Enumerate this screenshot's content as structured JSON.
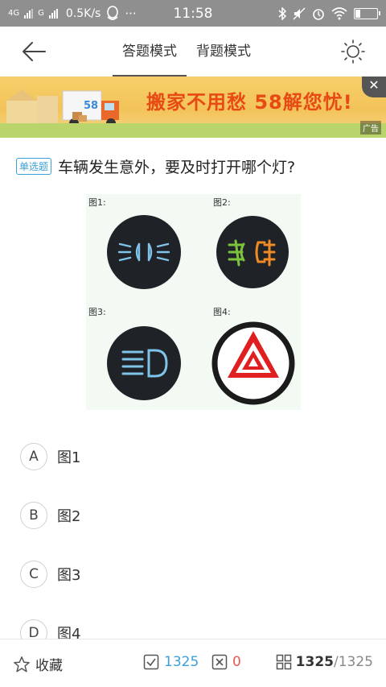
{
  "status_bar": {
    "network1": "4G",
    "network2": "G",
    "speed": "0.5K/s",
    "more": "···",
    "time": "11:58"
  },
  "nav": {
    "tabs": [
      {
        "label": "答题模式",
        "active": true
      },
      {
        "label": "背题模式",
        "active": false
      }
    ]
  },
  "ad": {
    "slogan": "搬家不用愁 58解您忧!",
    "brand": "58",
    "tag": "广告",
    "close": "✕"
  },
  "question": {
    "type": "单选题",
    "text": "车辆发生意外，要及时打开哪个灯?",
    "figure_labels": [
      "图1:",
      "图2:",
      "图3:",
      "图4:"
    ]
  },
  "options": [
    {
      "key": "A",
      "text": "图1"
    },
    {
      "key": "B",
      "text": "图2"
    },
    {
      "key": "C",
      "text": "图3"
    },
    {
      "key": "D",
      "text": "图4"
    }
  ],
  "bottom": {
    "favorite": "收藏",
    "correct_count": "1325",
    "wrong_count": "0",
    "current": "1325",
    "total": "/1325"
  },
  "colors": {
    "accent": "#3aa0d8",
    "wrong": "#e85a4f",
    "hazard": "#e02020",
    "fog_green": "#7cc33b",
    "fog_orange": "#f08a24",
    "lamp_blue": "#7fc4e8"
  }
}
